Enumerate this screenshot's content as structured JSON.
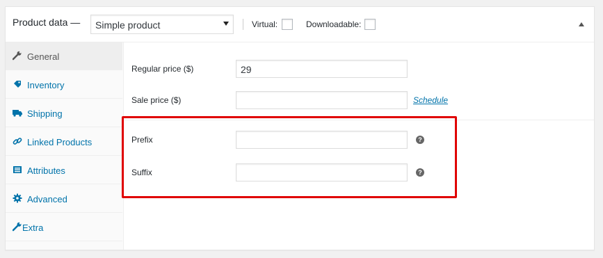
{
  "header": {
    "title": "Product data —",
    "product_type": "Simple product",
    "virtual_label": "Virtual:",
    "downloadable_label": "Downloadable:"
  },
  "tabs": [
    {
      "label": "General",
      "icon": "wrench-icon",
      "active": true
    },
    {
      "label": "Inventory",
      "icon": "tag-icon"
    },
    {
      "label": "Shipping",
      "icon": "truck-icon"
    },
    {
      "label": "Linked Products",
      "icon": "link-icon"
    },
    {
      "label": "Attributes",
      "icon": "list-icon"
    },
    {
      "label": "Advanced",
      "icon": "gear-icon"
    },
    {
      "label": "Extra",
      "icon": "wrench-icon"
    }
  ],
  "fields": {
    "regular_price_label": "Regular price ($)",
    "regular_price_value": "29",
    "sale_price_label": "Sale price ($)",
    "sale_price_value": "",
    "schedule_link": "Schedule",
    "prefix_label": "Prefix",
    "prefix_value": "",
    "suffix_label": "Suffix",
    "suffix_value": "",
    "help_glyph": "?"
  },
  "colors": {
    "link": "#0073aa",
    "highlight": "#e00000"
  }
}
